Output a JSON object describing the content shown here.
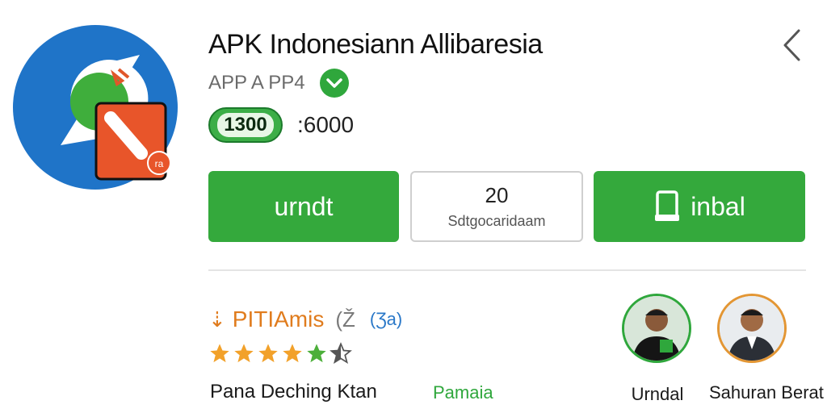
{
  "app": {
    "title": "APK Indonesiann Allibaresia",
    "subtitle": "APP A PP4",
    "pill_value": "1300",
    "stat_value": ":6000",
    "icon": "chat-bubble-app-icon"
  },
  "buttons": {
    "primary_label": "urndt",
    "middle_number": "20",
    "middle_label": "Sdtgocaridaam",
    "secondary_label": "inbal"
  },
  "section": {
    "title": "PITIAmis",
    "paren": "(Ž",
    "count": "(Ʒa)"
  },
  "rating": {
    "value": 4.5,
    "max": 5
  },
  "review": {
    "reviewer": "Pana Deching Ktan",
    "tag": "Pamaia"
  },
  "people": [
    {
      "name": "Urndal"
    },
    {
      "name": "Sahuran Berat"
    }
  ],
  "colors": {
    "green": "#34a93c",
    "orange": "#e07c1e",
    "blue": "#1f74c8"
  }
}
